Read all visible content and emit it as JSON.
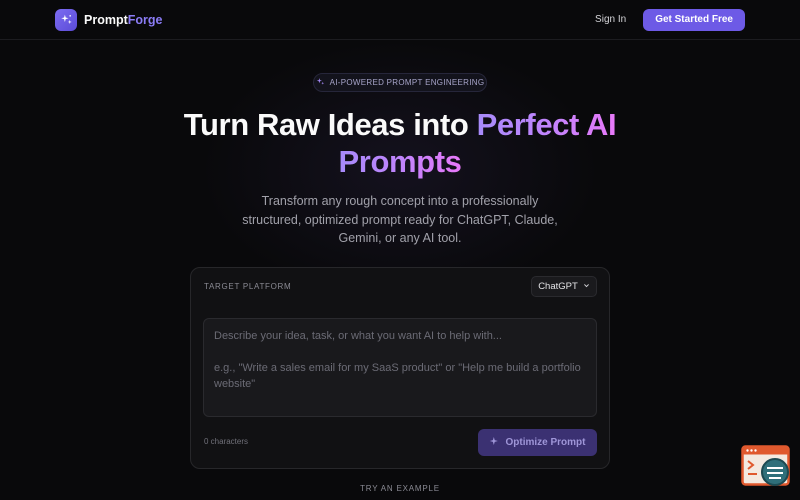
{
  "nav": {
    "brand_primary": "Prompt",
    "brand_accent": "Forge",
    "sign_in": "Sign In",
    "cta": "Get Started Free"
  },
  "hero": {
    "badge": "AI-POWERED PROMPT ENGINEERING",
    "headline_plain": "Turn Raw Ideas into",
    "headline_accent_1": "Perfect AI",
    "headline_accent_2": "Prompts",
    "subtitle": "Transform any rough concept into a professionally structured, optimized prompt ready for ChatGPT, Claude, Gemini, or any AI tool."
  },
  "card": {
    "platform_label": "TARGET PLATFORM",
    "platform_value": "ChatGPT",
    "input_value": "",
    "input_placeholder": "Describe your idea, task, or what you want AI to help with...\n\ne.g., \"Write a sales email for my SaaS product\" or \"Help me build a portfolio website\"",
    "char_count": "0 characters",
    "optimize_label": "Optimize Prompt"
  },
  "examples": {
    "heading": "TRY AN EXAMPLE"
  },
  "colors": {
    "accent": "#6d5ae6",
    "background": "#09090b",
    "gradient_start": "#a78bfa",
    "gradient_end": "#e879f9"
  },
  "icons": {
    "logo": "sparkle-icon",
    "badge": "sparkle-icon",
    "platform": "chevron-down-icon",
    "optimize": "sparkle-icon",
    "widget": "code-terminal-icon"
  }
}
